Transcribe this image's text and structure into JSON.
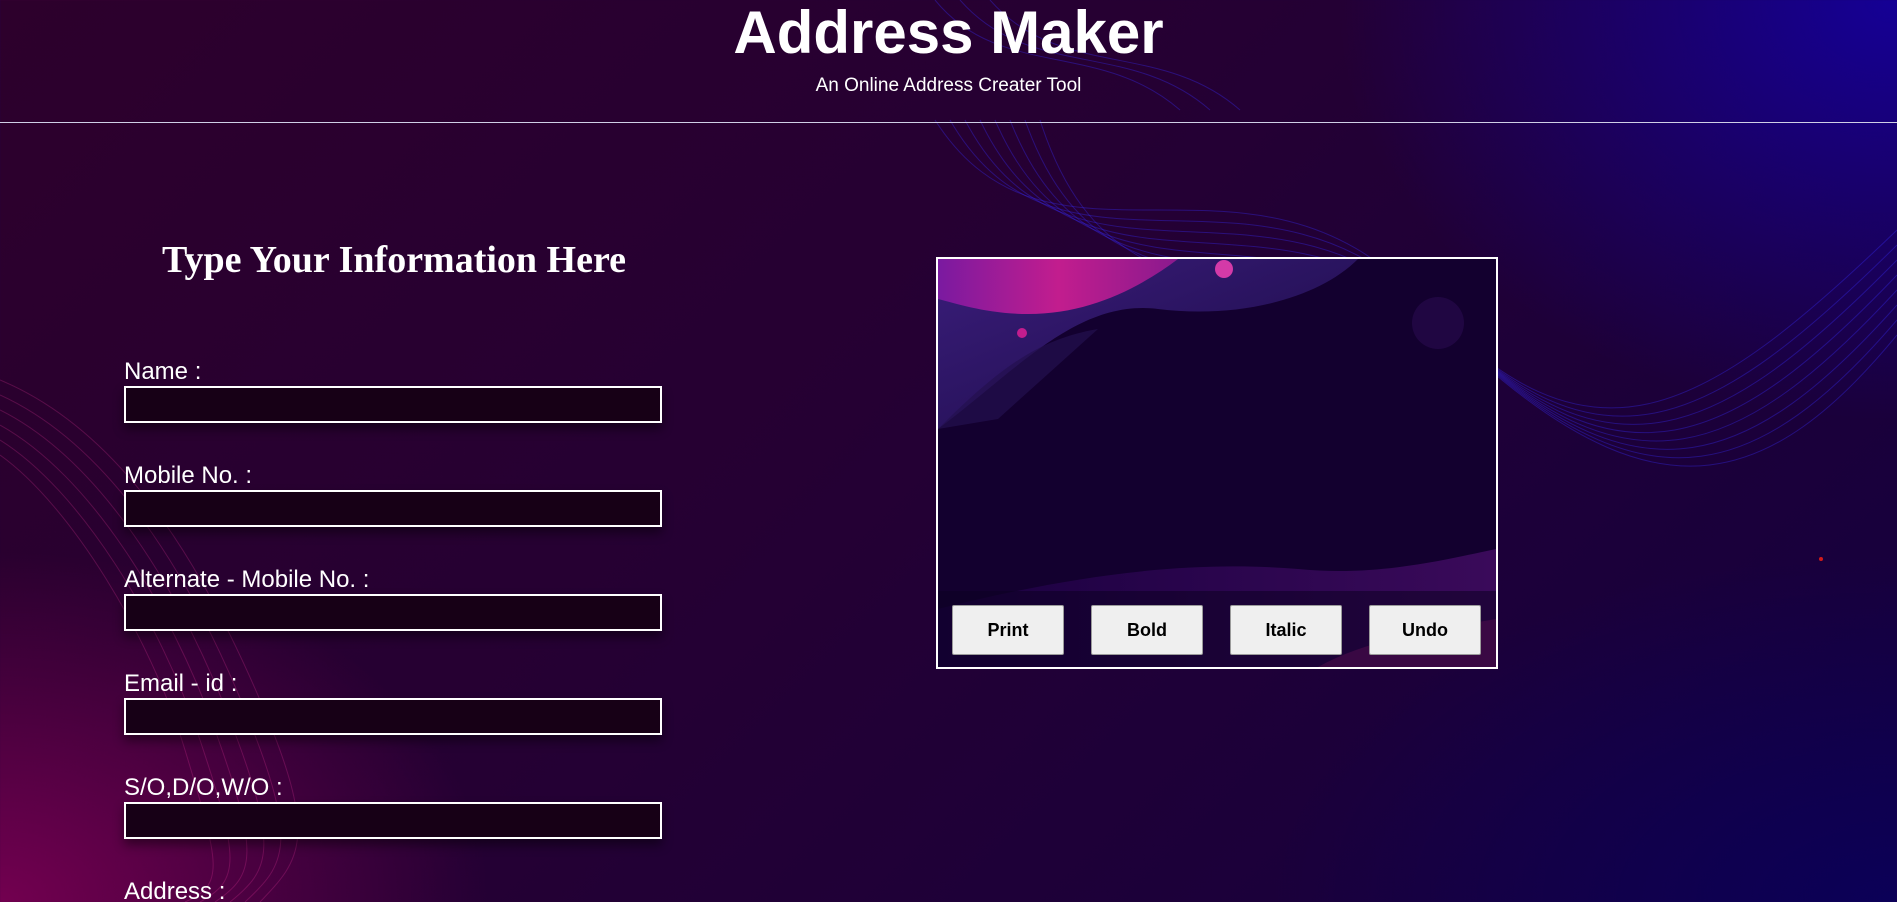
{
  "header": {
    "title": "Address Maker",
    "subtitle": "An Online Address Creater Tool"
  },
  "form": {
    "heading": "Type Your Information Here",
    "fields": [
      {
        "label": "Name :",
        "value": ""
      },
      {
        "label": "Mobile No. :",
        "value": ""
      },
      {
        "label": "Alternate - Mobile No. :",
        "value": ""
      },
      {
        "label": "Email - id :",
        "value": ""
      },
      {
        "label": "S/O,D/O,W/O :",
        "value": ""
      },
      {
        "label": "Address :",
        "value": ""
      }
    ]
  },
  "preview": {
    "buttons": {
      "print": "Print",
      "bold": "Bold",
      "italic": "Italic",
      "undo": "Undo"
    }
  },
  "colors": {
    "background_start": "#2d002c",
    "background_end": "#14003f",
    "accent_pink": "#c21d8e",
    "accent_blue": "#2a1aff",
    "input_background": "#170016",
    "button_background": "#efefef"
  }
}
